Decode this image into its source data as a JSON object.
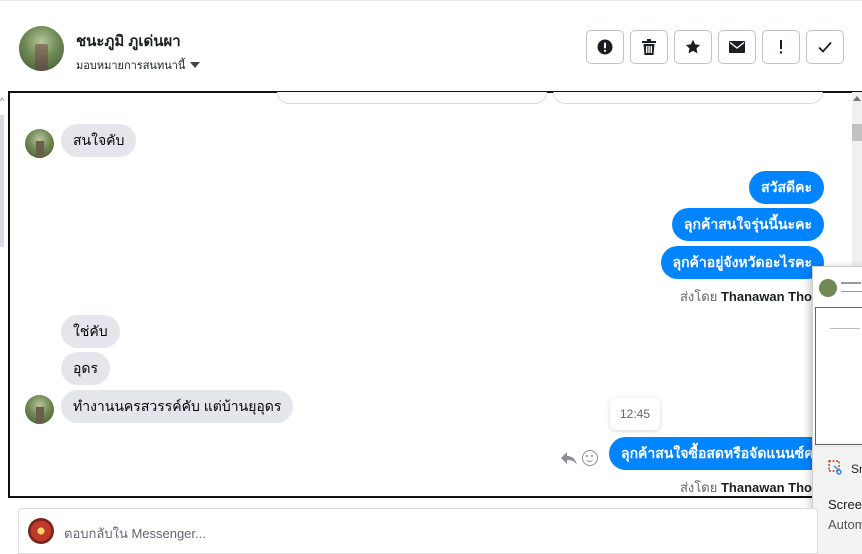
{
  "header": {
    "contact_name": "ชนะภูมิ ภูเด่นผา",
    "assign_label": "มอบหมายการสนทนานี้",
    "actions": [
      {
        "id": "spam",
        "icon": "exclamation-circle-icon"
      },
      {
        "id": "delete",
        "icon": "trash-icon"
      },
      {
        "id": "star",
        "icon": "star-icon"
      },
      {
        "id": "unread",
        "icon": "envelope-icon"
      },
      {
        "id": "important",
        "text": "!",
        "icon": "exclamation-icon"
      },
      {
        "id": "done",
        "icon": "check-icon"
      }
    ]
  },
  "conversation": {
    "incoming_1": "สนใจคับ",
    "outgoing_1": "สวัสดีคะ",
    "outgoing_2": "ลุกค้าสนใจรุ่นนี้นะคะ",
    "outgoing_3": "ลุกค้าอยู่จังหวัดอะไรคะ",
    "sent_by_prefix": "ส่งโดย",
    "sent_by_name": "Thanawan Thon",
    "incoming_2": "ใช่คับ",
    "incoming_3": "อุดร",
    "incoming_4": "ทำงานนครสวรรค์คับ แต่บ้านยุอุดร",
    "timestamp": "12:45",
    "outgoing_4": "ลุกค้าสนใจซื้อสดหรือจัดแนนซ์คะ"
  },
  "overlay": {
    "snip_app": "Sn",
    "snip_title": "Screen",
    "snip_sub": "Autom"
  },
  "composer": {
    "placeholder": "ตอบกลับใน Messenger..."
  },
  "colors": {
    "outgoing_bubble": "#0084ff",
    "incoming_bubble": "#e4e6eb"
  }
}
